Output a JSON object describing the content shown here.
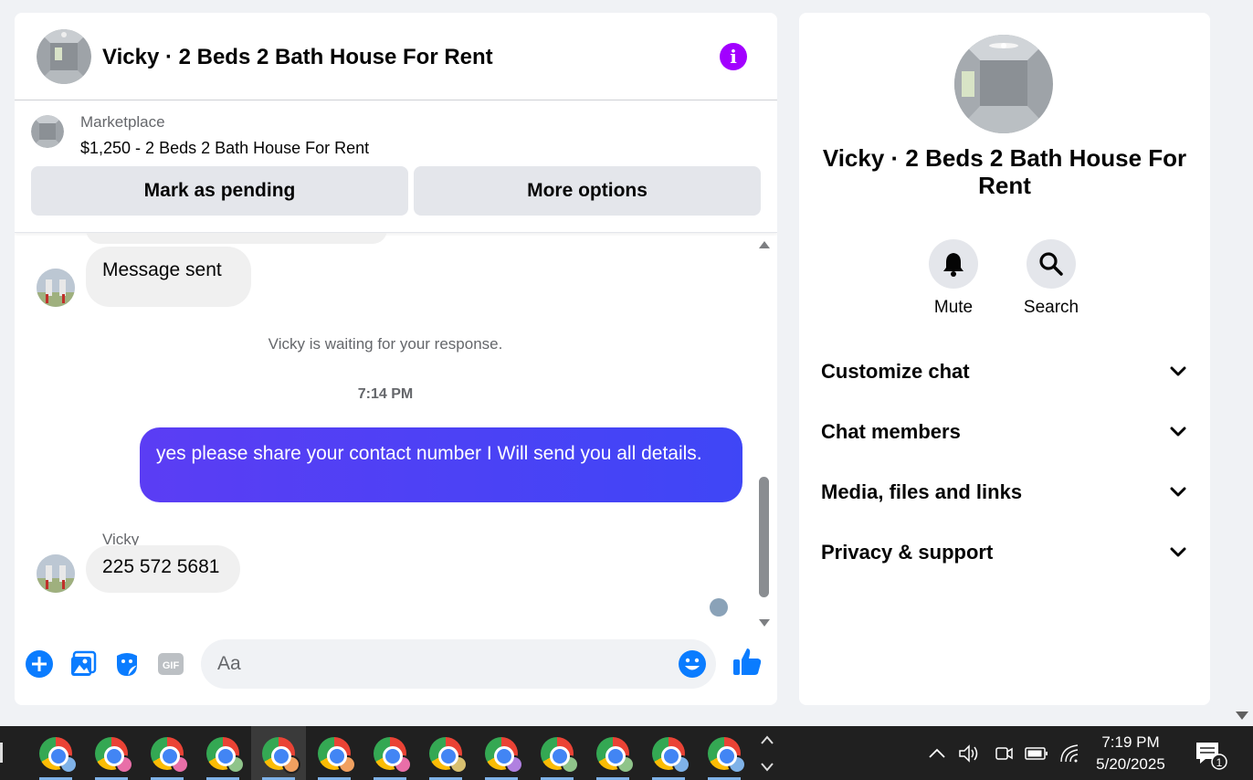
{
  "chat": {
    "title": "Vicky · 2 Beds 2 Bath House For Rent",
    "info_icon": "info-icon",
    "marketplace": {
      "label": "Marketplace",
      "listing": "$1,250 - 2 Beds 2 Bath House For Rent",
      "pending_button": "Mark as pending",
      "more_button": "More options"
    },
    "messages": {
      "first": "Message sent",
      "system": "Vicky is waiting for your response.",
      "timestamp": "7:14 PM",
      "outgoing": "yes please share your contact number I Will send you all details.",
      "sender": "Vicky",
      "incoming": "225 572 5681"
    },
    "composer": {
      "placeholder": "Aa",
      "tools": [
        "plus-icon",
        "photo-icon",
        "sticker-icon",
        "gif-icon",
        "emoji-icon",
        "like-icon"
      ],
      "gif_label": "GIF"
    },
    "accent": "#0a7cff",
    "outgoing_gradient": [
      "#5b3df4",
      "#3f46f6"
    ]
  },
  "side": {
    "title": "Vicky · 2 Beds 2 Bath House For Rent",
    "actions": [
      {
        "label": "Mute",
        "icon": "bell-icon"
      },
      {
        "label": "Search",
        "icon": "search-icon"
      }
    ],
    "sections": [
      "Customize chat",
      "Chat members",
      "Media, files and links",
      "Privacy & support"
    ]
  },
  "taskbar": {
    "apps_count": 13,
    "profile_colors": [
      "#7fb2e8",
      "#e86fa8",
      "#e86fa8",
      "#8fc48a",
      "#f0a060",
      "#f0a060",
      "#e86fa8",
      "#d8c070",
      "#b080e0",
      "#8fc48a",
      "#8fc48a",
      "#7fb2e8",
      "#7fb2e8"
    ],
    "time": "7:19 PM",
    "date": "5/20/2025",
    "notification_count": "1"
  }
}
